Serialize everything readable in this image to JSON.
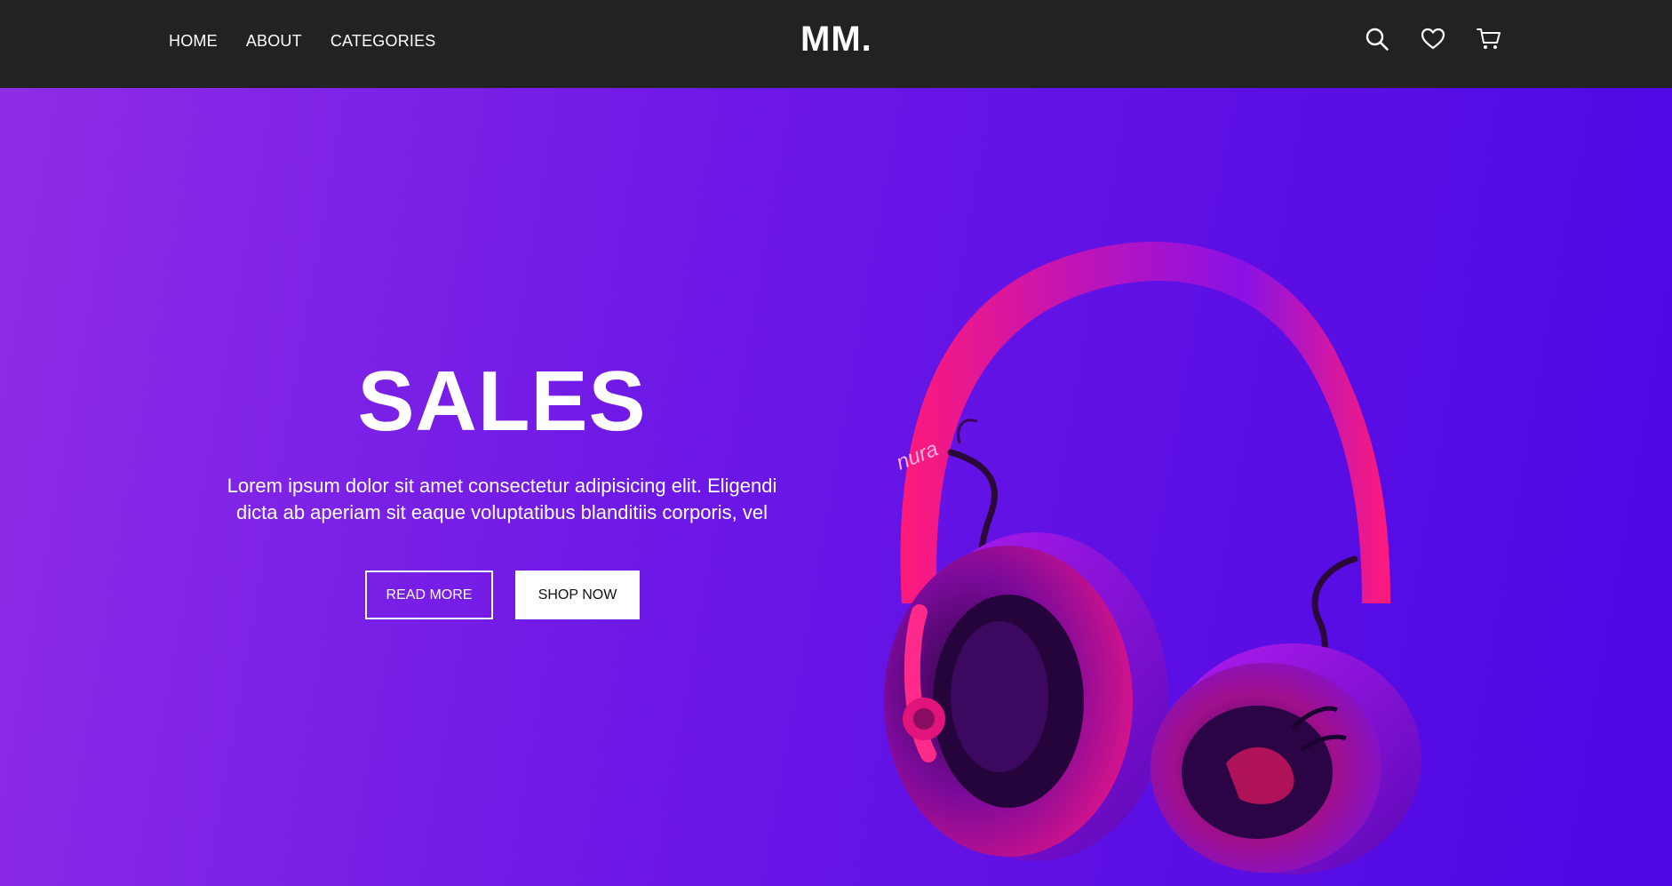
{
  "nav": {
    "links": [
      "HOME",
      "ABOUT",
      "CATEGORIES"
    ],
    "logo": "MM.",
    "icons": [
      "search-icon",
      "heart-icon",
      "cart-icon"
    ]
  },
  "hero": {
    "title": "SALES",
    "description_line1": "Lorem ipsum dolor sit amet consectetur adipisicing elit. Eligendi",
    "description_line2": "dicta ab aperiam sit eaque voluptatibus blanditiis corporis, vel",
    "read_more_label": "READ MORE",
    "shop_now_label": "SHOP NOW",
    "product_brand": "nura"
  },
  "colors": {
    "navbar": "#222222",
    "gradient_start": "#8e2ce5",
    "gradient_end": "#4c07e3",
    "headphone_pink": "#ff1a7a",
    "headphone_purple": "#7a10e8"
  }
}
